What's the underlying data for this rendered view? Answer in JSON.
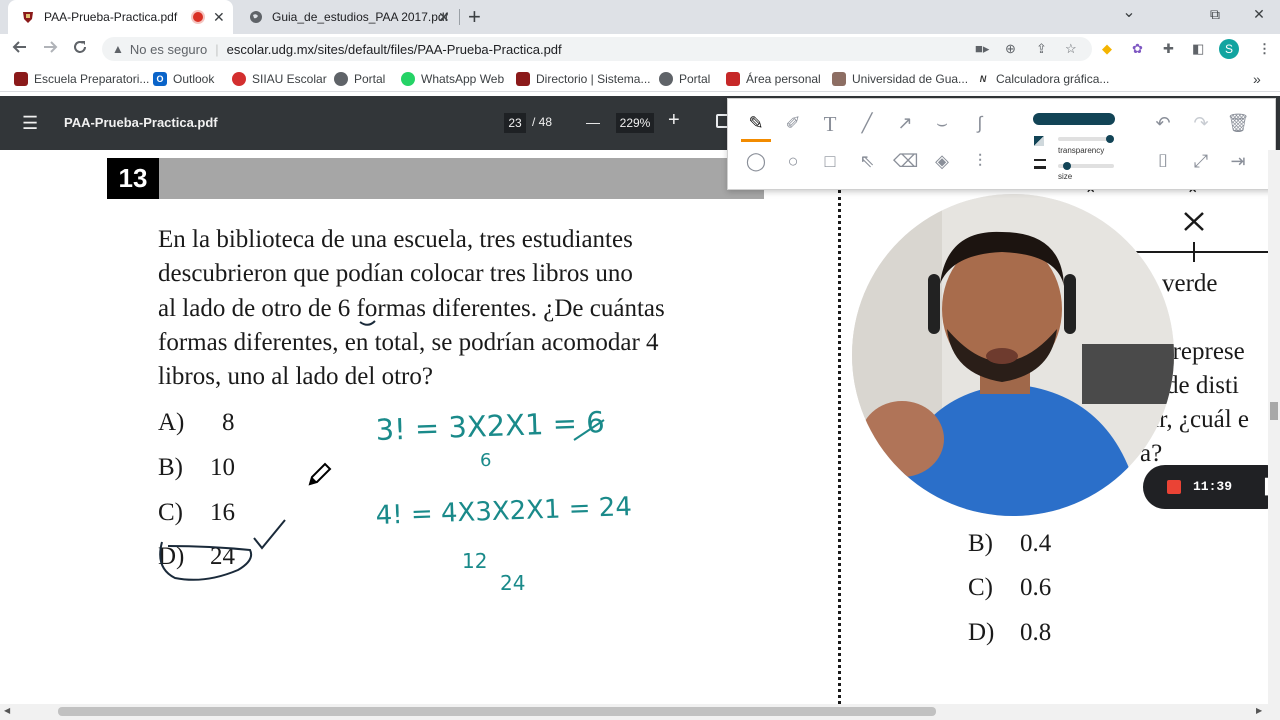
{
  "tabs": [
    {
      "title": "PAA-Prueba-Practica.pdf",
      "active": true,
      "recording": true
    },
    {
      "title": "Guia_de_estudios_PAA 2017.pdf",
      "active": false
    }
  ],
  "new_tab": "+",
  "window": {
    "chevron": "⌄",
    "restore": "⧉",
    "close": "✕"
  },
  "address": {
    "security": "No es seguro",
    "separator": "|",
    "url": "escolar.udg.mx/sites/default/files/PAA-Prueba-Practica.pdf"
  },
  "bookmarks": [
    {
      "label": "Escuela Preparatori...",
      "icon": "school-crest-icon",
      "color": "#8b1a1a"
    },
    {
      "label": "Outlook",
      "icon": "outlook-icon",
      "color": "#0a64c9"
    },
    {
      "label": "SIIAU Escolar",
      "icon": "siiau-icon",
      "color": "#d32f2f"
    },
    {
      "label": "Portal",
      "icon": "globe-icon",
      "color": "#5f6368"
    },
    {
      "label": "WhatsApp Web",
      "icon": "whatsapp-icon",
      "color": "#25d366"
    },
    {
      "label": "Directorio | Sistema...",
      "icon": "udg-crest-icon",
      "color": "#8b1a1a"
    },
    {
      "label": "Portal",
      "icon": "globe-icon",
      "color": "#5f6368"
    },
    {
      "label": "Área personal",
      "icon": "area-personal-icon",
      "color": "#c62828"
    },
    {
      "label": "Universidad de Gua...",
      "icon": "university-icon",
      "color": "#8d6e63"
    },
    {
      "label": "Calculadora gráfica...",
      "icon": "desmos-icon",
      "color": "#333333"
    }
  ],
  "bookmarks_more": "»",
  "pdf": {
    "menu_icon": "☰",
    "filename": "PAA-Prueba-Practica.pdf",
    "page": "23",
    "total": "/ 48",
    "zoom": "229%",
    "minus": "—",
    "plus": "+"
  },
  "question": {
    "number": "13",
    "lines": [
      "En la biblioteca de una escuela, tres estudiantes",
      "descubrieron que podían colocar tres libros uno",
      "al lado de otro de 6 formas diferentes. ¿De cuántas",
      "formas diferentes, en total, se podrían acomodar 4",
      "libros, uno al lado del otro?"
    ],
    "options": [
      {
        "letter": "A)",
        "value": "8"
      },
      {
        "letter": "B)",
        "value": "10"
      },
      {
        "letter": "C)",
        "value": "16"
      },
      {
        "letter": "D)",
        "value": "24"
      }
    ]
  },
  "handwriting": {
    "line1": "3! = 3X2X1 = 6",
    "note1": "6",
    "line2": "4! = 4X3X2X1 = 24",
    "note2": "12",
    "note3": "24",
    "ink_color": "#1a8a8a"
  },
  "right_page": {
    "word": "verde",
    "fragments": [
      "r represe",
      "s de disti",
      "ar, ¿cuál e",
      "a?"
    ],
    "options": [
      {
        "letter": "B)",
        "value": "0.4"
      },
      {
        "letter": "C)",
        "value": "0.6"
      },
      {
        "letter": "D)",
        "value": "0.8"
      }
    ]
  },
  "annotation_panel": {
    "transparency_label": "transparency",
    "size_label": "size",
    "pen_color": "#124456",
    "transparency": 0.95,
    "size": 0.15
  },
  "recorder": {
    "time": "11:39",
    "pause": "❚❚"
  }
}
